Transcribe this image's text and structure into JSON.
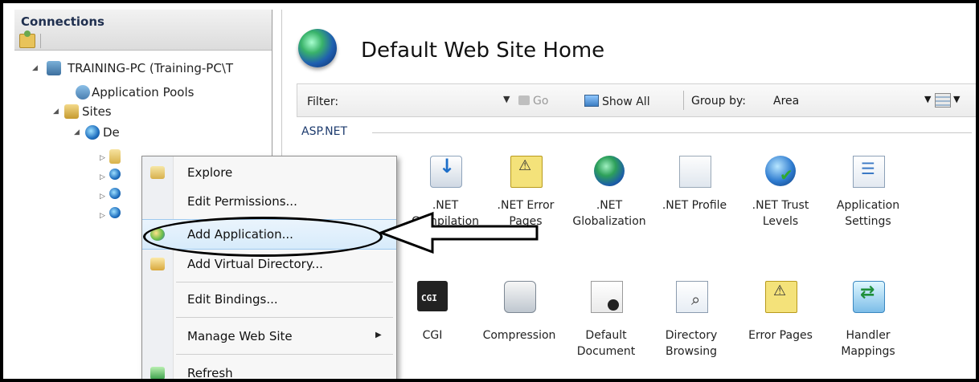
{
  "connections": {
    "title": "Connections",
    "tree": {
      "server": "TRAINING-PC (Training-PC\\T",
      "app_pools": "Application Pools",
      "sites": "Sites",
      "default_site": "De"
    }
  },
  "main": {
    "title": "Default Web Site Home",
    "filter": {
      "filter_label": "Filter:",
      "go_label": "Go",
      "show_all_label": "Show All",
      "group_by_label": "Group by:",
      "group_by_value": "Area"
    },
    "section_label": "ASP.NET",
    "features_row1": [
      {
        "icon": "net-compilation-icon",
        "label": ".NET\nCompilation"
      },
      {
        "icon": "net-error-pages-icon",
        "label": ".NET Error\nPages"
      },
      {
        "icon": "net-globalization-icon",
        "label": ".NET\nGlobalization"
      },
      {
        "icon": "net-profile-icon",
        "label": ".NET Profile"
      },
      {
        "icon": "net-trust-levels-icon",
        "label": ".NET Trust\nLevels"
      },
      {
        "icon": "application-settings-icon",
        "label": "Application\nSettings"
      }
    ],
    "features_row2": [
      {
        "icon": "cgi-icon",
        "label": "CGI"
      },
      {
        "icon": "compression-icon",
        "label": "Compression"
      },
      {
        "icon": "default-document-icon",
        "label": "Default\nDocument"
      },
      {
        "icon": "directory-browsing-icon",
        "label": "Directory\nBrowsing"
      },
      {
        "icon": "error-pages-icon",
        "label": "Error Pages"
      },
      {
        "icon": "handler-mappings-icon",
        "label": "Handler\nMappings"
      }
    ]
  },
  "context_menu": {
    "items": [
      {
        "label": "Explore",
        "icon": "explore-icon"
      },
      {
        "label": "Edit Permissions...",
        "icon": ""
      },
      {
        "label": "Add Application...",
        "icon": "add-application-icon"
      },
      {
        "label": "Add Virtual Directory...",
        "icon": "add-virtual-directory-icon"
      },
      {
        "label": "Edit Bindings...",
        "icon": ""
      },
      {
        "label": "Manage Web Site",
        "icon": ""
      },
      {
        "label": "Refresh",
        "icon": "refresh-icon"
      }
    ]
  }
}
